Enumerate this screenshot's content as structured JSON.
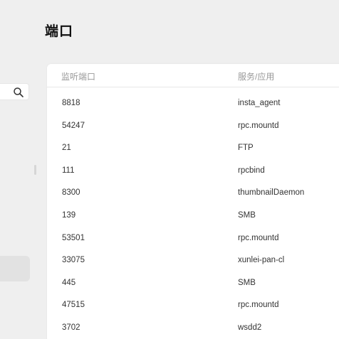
{
  "page": {
    "title": "端口"
  },
  "sidebar": {
    "search_icon": "search-icon"
  },
  "table": {
    "headers": {
      "port": "监听端口",
      "service": "服务/应用"
    },
    "rows": [
      {
        "port": "8818",
        "service": "insta_agent"
      },
      {
        "port": "54247",
        "service": "rpc.mountd"
      },
      {
        "port": "21",
        "service": "FTP"
      },
      {
        "port": "111",
        "service": "rpcbind"
      },
      {
        "port": "8300",
        "service": "thumbnailDaemon"
      },
      {
        "port": "139",
        "service": "SMB"
      },
      {
        "port": "53501",
        "service": "rpc.mountd"
      },
      {
        "port": "33075",
        "service": "xunlei-pan-cl"
      },
      {
        "port": "445",
        "service": "SMB"
      },
      {
        "port": "47515",
        "service": "rpc.mountd"
      },
      {
        "port": "3702",
        "service": "wsdd2"
      }
    ]
  }
}
